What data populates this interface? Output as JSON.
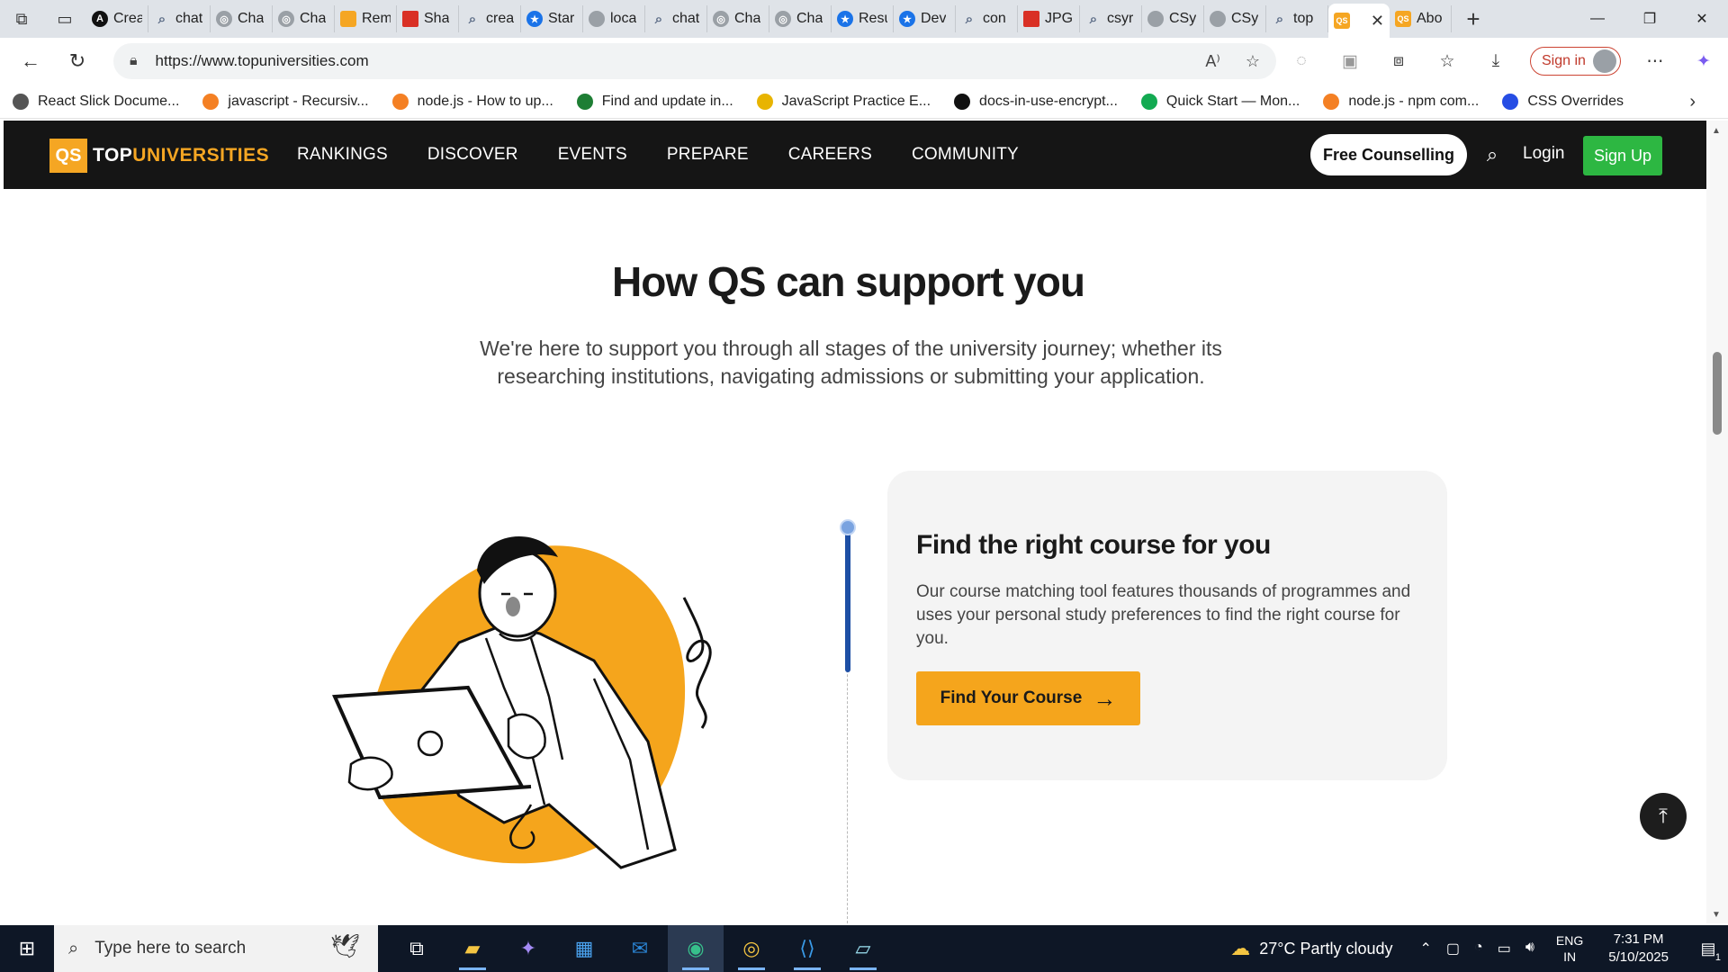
{
  "browser": {
    "tabs": [
      {
        "title": "Crea",
        "icon": "black-circle",
        "fav": "A"
      },
      {
        "title": "chat",
        "icon": "search-icon"
      },
      {
        "title": "Cha",
        "icon": "openai-icon"
      },
      {
        "title": "Cha",
        "icon": "openai-icon"
      },
      {
        "title": "Rem",
        "icon": "rem-icon"
      },
      {
        "title": "Sha",
        "icon": "image-icon"
      },
      {
        "title": "crea",
        "icon": "search-icon"
      },
      {
        "title": "Star",
        "icon": "star-icon"
      },
      {
        "title": "loca",
        "icon": "file-icon"
      },
      {
        "title": "chat",
        "icon": "search-icon"
      },
      {
        "title": "Cha",
        "icon": "openai-icon"
      },
      {
        "title": "Cha",
        "icon": "openai-icon"
      },
      {
        "title": "Resu",
        "icon": "star-icon"
      },
      {
        "title": "Dev",
        "icon": "star-icon"
      },
      {
        "title": "con",
        "icon": "search-icon"
      },
      {
        "title": "JPG",
        "icon": "jpg-icon"
      },
      {
        "title": "csyr",
        "icon": "search-icon"
      },
      {
        "title": "CSy",
        "icon": "csy-icon"
      },
      {
        "title": "CSy",
        "icon": "csy-icon"
      },
      {
        "title": "top",
        "icon": "search-icon"
      }
    ],
    "active_tab": {
      "icon": "qs-icon",
      "fav": "QS"
    },
    "next_tab": {
      "title": "Abo",
      "icon": "qs-icon",
      "fav": "QS"
    },
    "url": "https://www.topuniversities.com",
    "signin_label": "Sign in"
  },
  "bookmarks": [
    {
      "label": "React Slick Docume...",
      "icon": "globe-icon"
    },
    {
      "label": "javascript - Recursiv...",
      "icon": "stackoverflow-icon"
    },
    {
      "label": "node.js - How to up...",
      "icon": "stackoverflow-icon"
    },
    {
      "label": "Find and update in...",
      "icon": "tl-icon"
    },
    {
      "label": "JavaScript Practice E...",
      "icon": "w3resource-icon"
    },
    {
      "label": "docs-in-use-encrypt...",
      "icon": "github-icon"
    },
    {
      "label": "Quick Start — Mon...",
      "icon": "mongodb-icon"
    },
    {
      "label": "node.js - npm com...",
      "icon": "stackoverflow-icon"
    },
    {
      "label": "CSS Overrides",
      "icon": "css-icon"
    }
  ],
  "site": {
    "logo_qs": "QS",
    "logo_top": "TOP",
    "logo_uni": "UNIVERSITIES",
    "nav": [
      "RANKINGS",
      "DISCOVER",
      "EVENTS",
      "PREPARE",
      "CAREERS",
      "COMMUNITY"
    ],
    "free_counselling": "Free Counselling",
    "login": "Login",
    "signup": "Sign Up",
    "colors": {
      "accent": "#f5a623",
      "header_bg": "#151515",
      "signup": "#2db742",
      "timeline": "#1d4fa5"
    }
  },
  "content": {
    "title": "How QS can support you",
    "subtitle": "We're here to support you through all stages of the university journey; whether its researching institutions, navigating admissions or submitting your application.",
    "card": {
      "title": "Find the right course for you",
      "description": "Our course matching tool features thousands of programmes and uses your personal study preferences to find the right course for you.",
      "button": "Find Your Course"
    }
  },
  "taskbar": {
    "search_placeholder": "Type here to search",
    "weather": "27°C  Partly cloudy",
    "lang_top": "ENG",
    "lang_bottom": "IN",
    "time": "7:31 PM",
    "date": "5/10/2025",
    "notif_count": "1"
  }
}
